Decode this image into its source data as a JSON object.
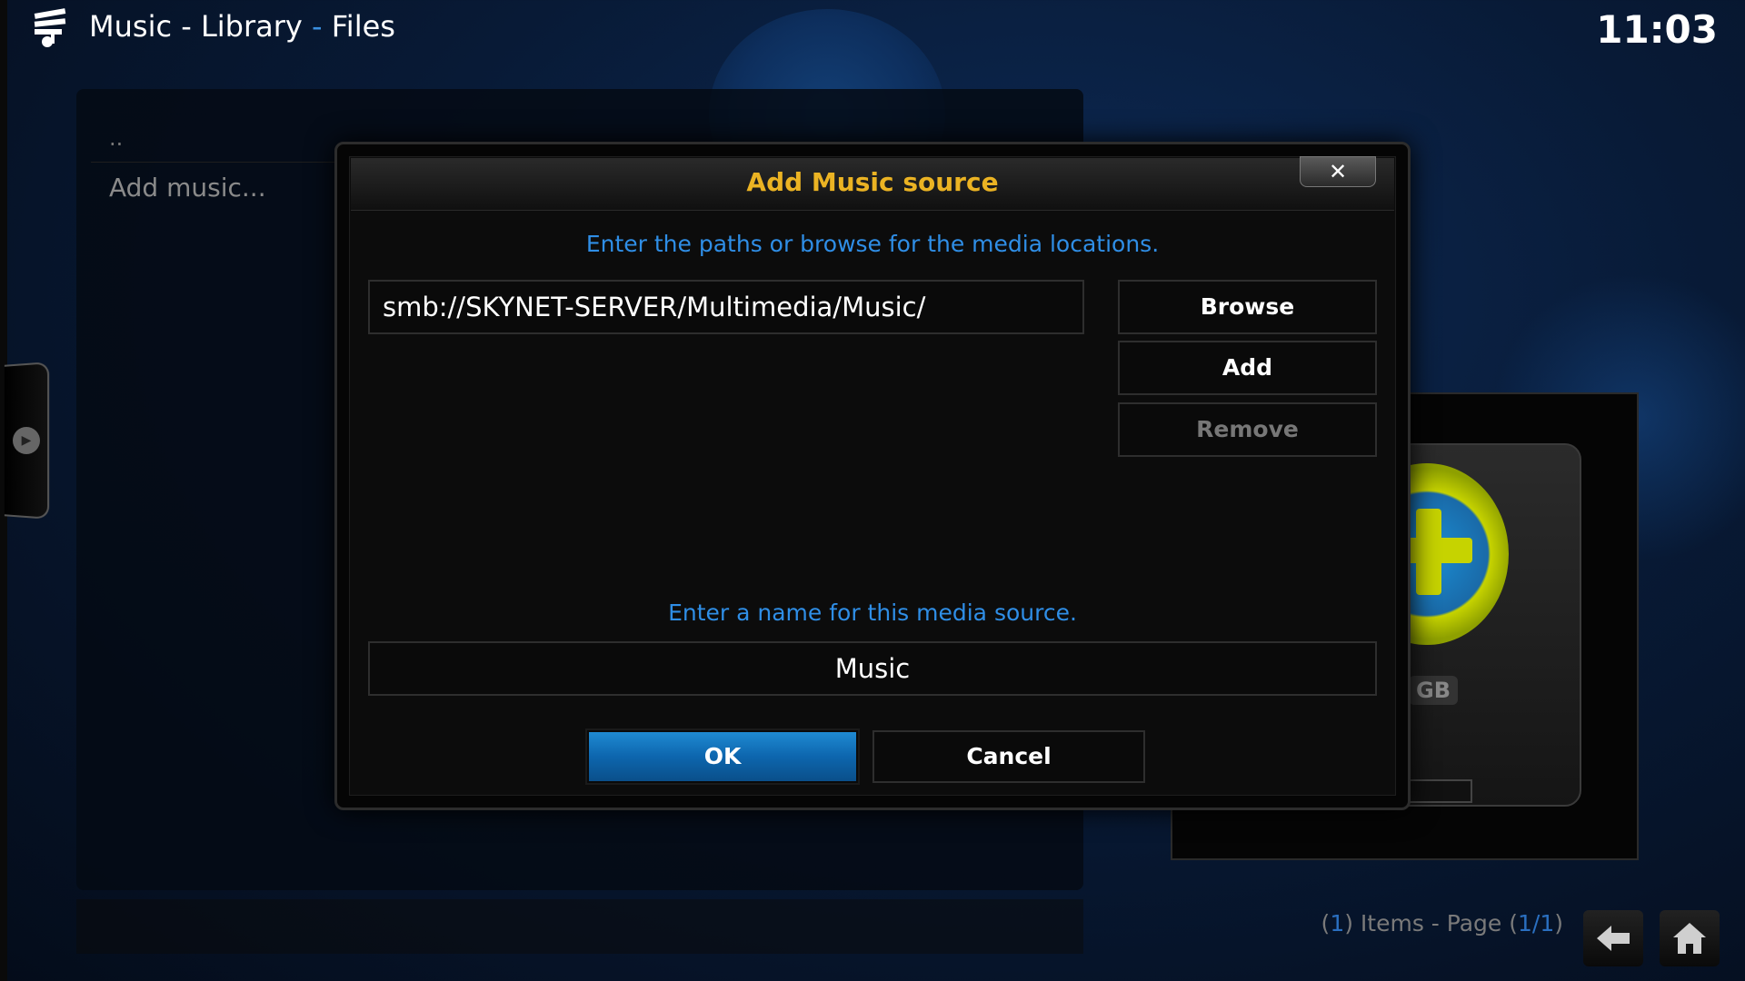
{
  "header": {
    "title_part1": "Music - Library",
    "separator": " - ",
    "title_part2": "Files",
    "clock": "11:03"
  },
  "list": {
    "parent_item": "..",
    "add_item": "Add music..."
  },
  "thumb": {
    "drive_label": "GB"
  },
  "footer": {
    "items_open": "(",
    "items_count": "1",
    "items_mid": ") Items - Page (",
    "page": "1/1",
    "items_close": ")"
  },
  "dialog": {
    "title": "Add Music source",
    "close_label": "✕",
    "paths_hint": "Enter the paths or browse for the media locations.",
    "path_value": "smb://SKYNET-SERVER/Multimedia/Music/",
    "browse_label": "Browse",
    "add_label": "Add",
    "remove_label": "Remove",
    "name_hint": "Enter a name for this media source.",
    "name_value": "Music",
    "ok_label": "OK",
    "cancel_label": "Cancel"
  },
  "colors": {
    "title_accent": "#ebb323",
    "hint_blue": "#2f8ee6",
    "ok_blue": "#0d66ae"
  }
}
